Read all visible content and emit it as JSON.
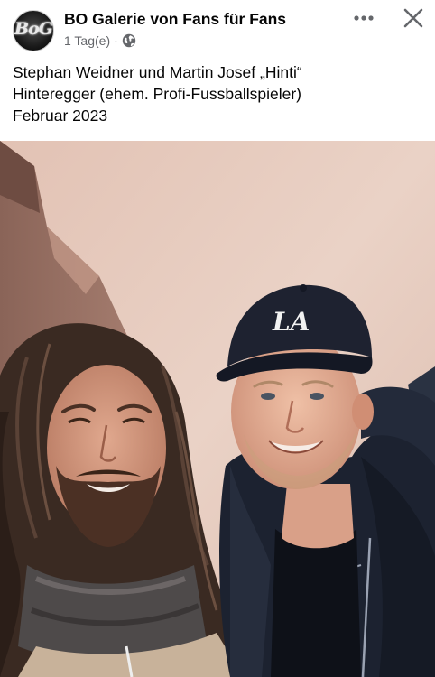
{
  "post": {
    "page_name": "BO Galerie von Fans für Fans",
    "avatar_text": "BoG",
    "time": "1 Tag(e)",
    "separator": "·",
    "caption_lines": [
      "Stephan Weidner und Martin Josef „Hinti“",
      "Hinteregger (ehem. Profi-Fussballspieler)",
      "Februar 2023"
    ],
    "cap_logo": "LA"
  },
  "icons": {
    "more": "more-options-icon",
    "close": "close-icon",
    "privacy": "globe-icon"
  },
  "colors": {
    "text": "#050505",
    "meta": "#65676b",
    "wall": "#e6c8bc",
    "jacket": "#1c2230",
    "cap": "#1e2230"
  }
}
